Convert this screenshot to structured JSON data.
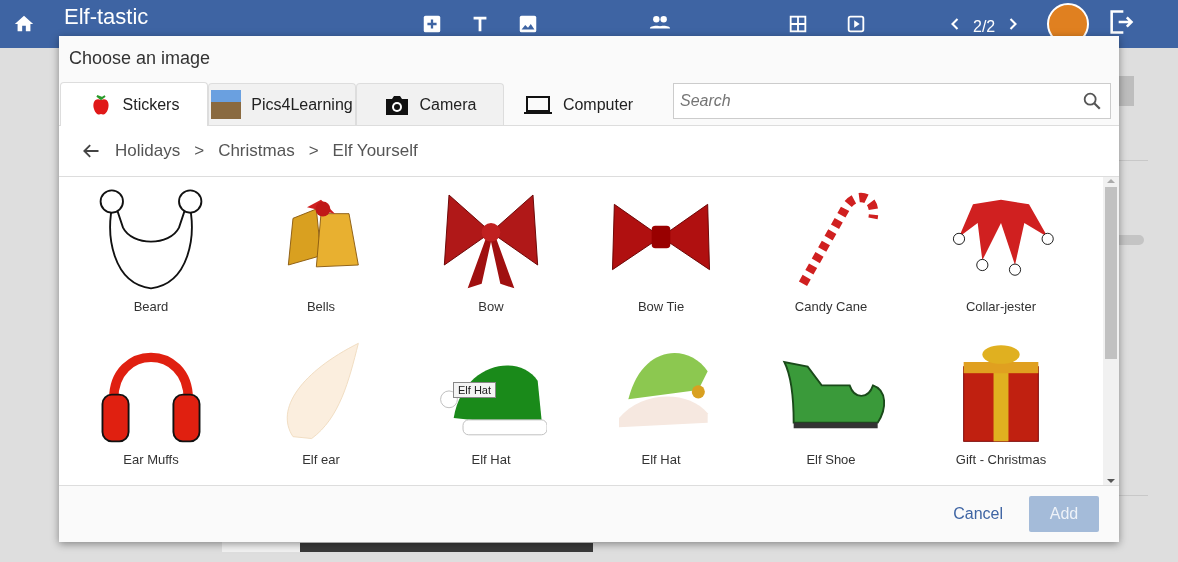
{
  "app_bar": {
    "title": "Elf-tastic",
    "page_indicator": "2/2"
  },
  "dialog": {
    "title": "Choose an image",
    "tabs": [
      {
        "label": "Stickers",
        "kind": "apple",
        "selected": true
      },
      {
        "label": "Pics4Learning",
        "kind": "photo",
        "selected": false
      },
      {
        "label": "Camera",
        "kind": "camera",
        "selected": false
      },
      {
        "label": "Computer",
        "kind": "laptop",
        "selected": false
      }
    ],
    "search": {
      "placeholder": "Search"
    },
    "breadcrumb": [
      "Holidays",
      "Christmas",
      "Elf Yourself"
    ],
    "breadcrumb_separators": [
      ">",
      ">"
    ],
    "stickers": [
      {
        "label": "Beard",
        "kind": "beard"
      },
      {
        "label": "Bells",
        "kind": "bells"
      },
      {
        "label": "Bow",
        "kind": "bow"
      },
      {
        "label": "Bow Tie",
        "kind": "bowtie"
      },
      {
        "label": "Candy Cane",
        "kind": "cane"
      },
      {
        "label": "Collar-jester",
        "kind": "collar"
      },
      {
        "label": "Ear Muffs",
        "kind": "earmuffs"
      },
      {
        "label": "Elf ear",
        "kind": "ear"
      },
      {
        "label": "Elf Hat",
        "kind": "hat",
        "tooltip": "Elf Hat"
      },
      {
        "label": "Elf Hat",
        "kind": "hat2"
      },
      {
        "label": "Elf Shoe",
        "kind": "shoe"
      },
      {
        "label": "Gift - Christmas",
        "kind": "gift"
      }
    ],
    "buttons": [
      {
        "label": "Cancel",
        "kind": "text",
        "disabled": false
      },
      {
        "label": "Add",
        "kind": "primary",
        "disabled": true
      }
    ]
  }
}
